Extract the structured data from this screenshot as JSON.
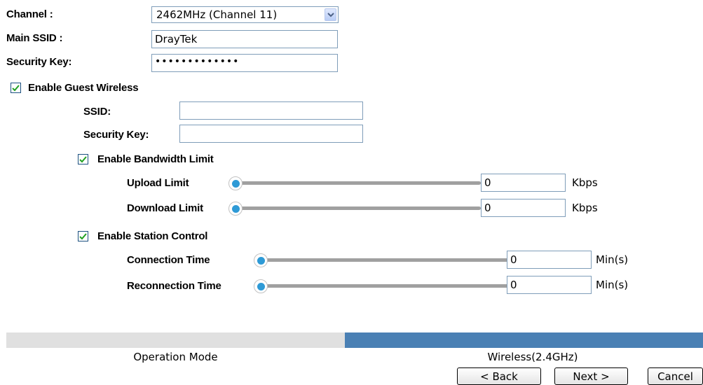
{
  "wireless": {
    "channel_label": "Channel :",
    "channel_value": "2462MHz (Channel 11)",
    "main_ssid_label": "Main SSID :",
    "main_ssid_value": "DrayTek",
    "security_key_label": "Security Key:",
    "security_key_value": "•••••••••••••"
  },
  "guest": {
    "enable_label": "Enable Guest Wireless",
    "enabled": true,
    "ssid_label": "SSID:",
    "ssid_value": "",
    "security_key_label": "Security Key:",
    "security_key_value": ""
  },
  "bandwidth": {
    "enable_label": "Enable Bandwidth Limit",
    "enabled": true,
    "upload_label": "Upload Limit",
    "upload_value": "0",
    "upload_unit": "Kbps",
    "download_label": "Download Limit",
    "download_value": "0",
    "download_unit": "Kbps"
  },
  "station": {
    "enable_label": "Enable Station Control",
    "enabled": true,
    "connection_label": "Connection Time",
    "connection_value": "0",
    "connection_unit": "Min(s)",
    "reconnection_label": "Reconnection Time",
    "reconnection_value": "0",
    "reconnection_unit": "Min(s)"
  },
  "wizard": {
    "steps": [
      "Operation Mode",
      "Wireless(2.4GHz)"
    ],
    "active_step": 1,
    "back_label": "< Back",
    "next_label": "Next >",
    "cancel_label": "Cancel"
  },
  "colors": {
    "step_inactive": "#e0e0e0",
    "step_active": "#4a80b4",
    "slider_dot": "#2e9ad6",
    "checkbox_mark": "#21a121"
  }
}
